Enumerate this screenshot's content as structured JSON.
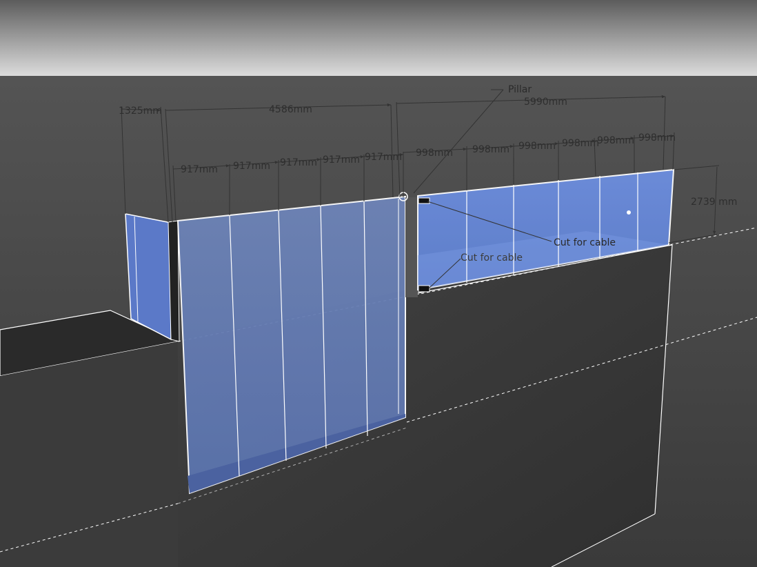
{
  "dimensions": {
    "left_return": "1325mm",
    "front_total": "4586mm",
    "rear_total": "5990mm",
    "front_panel_1": "917mm",
    "front_panel_2": "917mm",
    "front_panel_3": "917mm",
    "front_panel_4": "917mm",
    "front_panel_5": "917mm",
    "rear_panel_1": "998mm",
    "rear_panel_2": "998mm",
    "rear_panel_3": "998mm",
    "rear_panel_4": "998mm",
    "rear_panel_5": "998mm",
    "rear_panel_6": "998mm",
    "height": "2739 mm"
  },
  "labels": {
    "pillar": "Pillar",
    "cut_for_cable_top": "Cut for cable",
    "cut_for_cable_bottom": "Cut for cable"
  },
  "colors": {
    "sky_top": "#5a5a5a",
    "sky_bottom": "#d9d9d9",
    "ground": "#4a4a4a",
    "block_front": "#3d3d3d",
    "glass": "#6f8fd6",
    "glass_edge": "#ffffff",
    "dimension_line": "#3a3a3a"
  }
}
